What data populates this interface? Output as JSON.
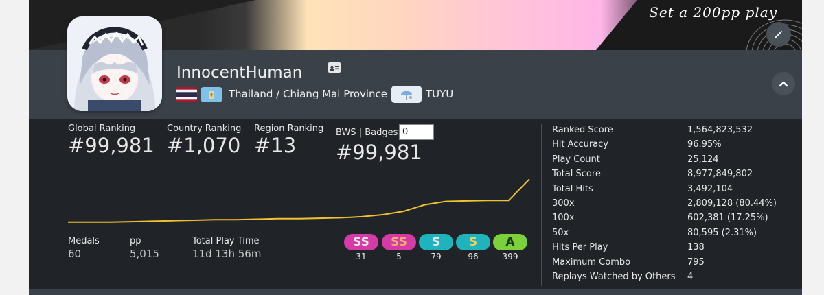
{
  "cover": {
    "title": "",
    "caption": "Set a 200pp play"
  },
  "user": {
    "username": "InnocentHuman",
    "location": "Thailand / Chiang Mai Province",
    "team": "TUYU"
  },
  "rankings": {
    "global_label": "Global Ranking",
    "global_value": "#99,981",
    "country_label": "Country Ranking",
    "country_value": "#1,070",
    "region_label": "Region Ranking",
    "region_value": "#13",
    "bws_label": "BWS | Badges:",
    "badges_input": "0",
    "bws_value": "#99,981"
  },
  "rank_history": [
    0.03,
    0.03,
    0.03,
    0.04,
    0.05,
    0.06,
    0.07,
    0.08,
    0.08,
    0.09,
    0.1,
    0.1,
    0.11,
    0.12,
    0.14,
    0.18,
    0.25,
    0.38,
    0.45,
    0.46,
    0.47,
    0.47,
    0.9
  ],
  "summary": {
    "medals_label": "Medals",
    "medals_value": "60",
    "pp_label": "pp",
    "pp_value": "5,015",
    "playtime_label": "Total Play Time",
    "playtime_value": "11d 13h 56m"
  },
  "grades": [
    {
      "label": "SS",
      "count": "31",
      "color": "#d63aa6",
      "text_color": "#e7e7e7"
    },
    {
      "label": "SS",
      "count": "5",
      "color": "#d63aa6",
      "text_color": "#f4b36a"
    },
    {
      "label": "S",
      "count": "79",
      "color": "#1fb3bd",
      "text_color": "#e7e7e7"
    },
    {
      "label": "S",
      "count": "96",
      "color": "#1fb3bd",
      "text_color": "#f0d060"
    },
    {
      "label": "A",
      "count": "399",
      "color": "#7cd13b",
      "text_color": "#1b3a0c"
    }
  ],
  "stats": [
    {
      "label": "Ranked Score",
      "value": "1,564,823,532"
    },
    {
      "label": "Hit Accuracy",
      "value": "96.95%"
    },
    {
      "label": "Play Count",
      "value": "25,124"
    },
    {
      "label": "Total Score",
      "value": "8,977,849,802"
    },
    {
      "label": "Total Hits",
      "value": "3,492,104"
    },
    {
      "label": "300x",
      "value": "2,809,128 (80.44%)"
    },
    {
      "label": "100x",
      "value": "602,381 (17.25%)"
    },
    {
      "label": "50x",
      "value": "80,595 (2.31%)"
    },
    {
      "label": "Hits Per Play",
      "value": "138"
    },
    {
      "label": "Maximum Combo",
      "value": "795"
    },
    {
      "label": "Replays Watched by Others",
      "value": "4"
    }
  ],
  "colors": {
    "graph_line": "#f2c230",
    "panel_bg": "#202428",
    "header_bg": "#3b4148"
  },
  "icons": {
    "edit": "pencil-icon",
    "collapse": "chevron-up-icon",
    "user_card": "id-card-icon"
  }
}
